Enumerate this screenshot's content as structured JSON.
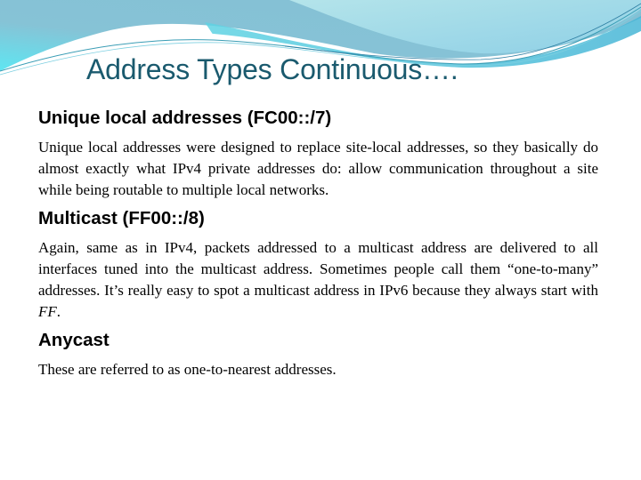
{
  "slide": {
    "title": "Address Types Continuous….",
    "sections": [
      {
        "heading": "Unique local addresses (FC00::/7)",
        "body": "Unique local addresses were designed to replace site-local addresses, so they basically do almost exactly what IPv4 private addresses do: allow communication throughout a site while being routable to multiple local networks."
      },
      {
        "heading": "Multicast (FF00::/8)",
        "body_before": "Again, same as in IPv4, packets addressed to a multicast address are delivered to all interfaces tuned into the multicast address. Sometimes people call them “one-to-many” addresses. It’s really easy to spot a multicast address in IPv6 because they always start with ",
        "body_emphasis": "FF",
        "body_after": "."
      },
      {
        "heading": "Anycast",
        "body": "These are referred to as one-to-nearest addresses."
      }
    ]
  },
  "theme": {
    "title_color": "#1a5a6e",
    "wave_dark": "#7fbcd2",
    "wave_light": "#a6dcea",
    "wave_cyan": "#66d8e8"
  }
}
